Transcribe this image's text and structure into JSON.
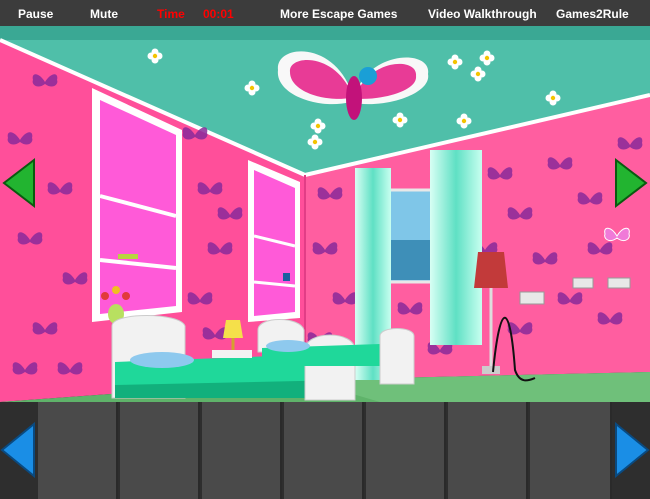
{
  "menu": {
    "pause": "Pause",
    "mute": "Mute",
    "time_label": "Time",
    "time_value": "00:01",
    "more_games": "More Escape Games",
    "walkthrough": "Video Walkthrough",
    "brand": "Games2Rule"
  },
  "colors": {
    "wall_pink": "#ff4f9a",
    "ceiling_teal": "#4fbfa9",
    "timer_red": "#ff0000",
    "nav_green": "#22b430",
    "nav_blue": "#1a8ee6",
    "butterfly_purple": "#8a2a9a"
  },
  "icons": {
    "left_nav": "green-left-arrow-icon",
    "right_nav": "green-right-arrow-icon",
    "inv_left": "blue-left-arrow-icon",
    "inv_right": "blue-right-arrow-icon"
  },
  "inventory": {
    "slots": 7
  }
}
